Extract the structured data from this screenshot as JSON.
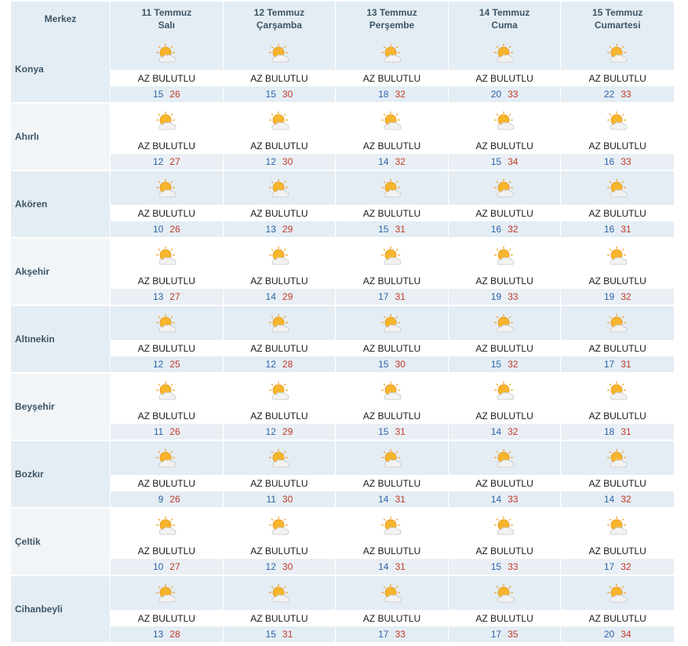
{
  "header": {
    "location_label": "Merkez",
    "days": [
      {
        "date": "11 Temmuz",
        "weekday": "Salı"
      },
      {
        "date": "12 Temmuz",
        "weekday": "Çarşamba"
      },
      {
        "date": "13 Temmuz",
        "weekday": "Perşembe"
      },
      {
        "date": "14 Temmuz",
        "weekday": "Cuma"
      },
      {
        "date": "15 Temmuz",
        "weekday": "Cumartesi"
      }
    ]
  },
  "icon": "partly-cloudy-icon",
  "colors": {
    "min": "#2b64a8",
    "max": "#c0392b",
    "band": "#e4edf4"
  },
  "rows": [
    {
      "name": "Konya",
      "days": [
        {
          "cond": "AZ BULUTLU",
          "min": "15",
          "max": "26"
        },
        {
          "cond": "AZ BULUTLU",
          "min": "15",
          "max": "30"
        },
        {
          "cond": "AZ BULUTLU",
          "min": "18",
          "max": "32"
        },
        {
          "cond": "AZ BULUTLU",
          "min": "20",
          "max": "33"
        },
        {
          "cond": "AZ BULUTLU",
          "min": "22",
          "max": "33"
        }
      ]
    },
    {
      "name": "Ahırlı",
      "days": [
        {
          "cond": "AZ BULUTLU",
          "min": "12",
          "max": "27"
        },
        {
          "cond": "AZ BULUTLU",
          "min": "12",
          "max": "30"
        },
        {
          "cond": "AZ BULUTLU",
          "min": "14",
          "max": "32"
        },
        {
          "cond": "AZ BULUTLU",
          "min": "15",
          "max": "34"
        },
        {
          "cond": "AZ BULUTLU",
          "min": "16",
          "max": "33"
        }
      ]
    },
    {
      "name": "Akören",
      "days": [
        {
          "cond": "AZ BULUTLU",
          "min": "10",
          "max": "26"
        },
        {
          "cond": "AZ BULUTLU",
          "min": "13",
          "max": "29"
        },
        {
          "cond": "AZ BULUTLU",
          "min": "15",
          "max": "31"
        },
        {
          "cond": "AZ BULUTLU",
          "min": "16",
          "max": "32"
        },
        {
          "cond": "AZ BULUTLU",
          "min": "16",
          "max": "31"
        }
      ]
    },
    {
      "name": "Akşehir",
      "days": [
        {
          "cond": "AZ BULUTLU",
          "min": "13",
          "max": "27"
        },
        {
          "cond": "AZ BULUTLU",
          "min": "14",
          "max": "29"
        },
        {
          "cond": "AZ BULUTLU",
          "min": "17",
          "max": "31"
        },
        {
          "cond": "AZ BULUTLU",
          "min": "19",
          "max": "33"
        },
        {
          "cond": "AZ BULUTLU",
          "min": "19",
          "max": "32"
        }
      ]
    },
    {
      "name": "Altınekin",
      "days": [
        {
          "cond": "AZ BULUTLU",
          "min": "12",
          "max": "25"
        },
        {
          "cond": "AZ BULUTLU",
          "min": "12",
          "max": "28"
        },
        {
          "cond": "AZ BULUTLU",
          "min": "15",
          "max": "30"
        },
        {
          "cond": "AZ BULUTLU",
          "min": "15",
          "max": "32"
        },
        {
          "cond": "AZ BULUTLU",
          "min": "17",
          "max": "31"
        }
      ]
    },
    {
      "name": "Beyşehir",
      "days": [
        {
          "cond": "AZ BULUTLU",
          "min": "11",
          "max": "26"
        },
        {
          "cond": "AZ BULUTLU",
          "min": "12",
          "max": "29"
        },
        {
          "cond": "AZ BULUTLU",
          "min": "15",
          "max": "31"
        },
        {
          "cond": "AZ BULUTLU",
          "min": "14",
          "max": "32"
        },
        {
          "cond": "AZ BULUTLU",
          "min": "18",
          "max": "31"
        }
      ]
    },
    {
      "name": "Bozkır",
      "days": [
        {
          "cond": "AZ BULUTLU",
          "min": "9",
          "max": "26"
        },
        {
          "cond": "AZ BULUTLU",
          "min": "11",
          "max": "30"
        },
        {
          "cond": "AZ BULUTLU",
          "min": "14",
          "max": "31"
        },
        {
          "cond": "AZ BULUTLU",
          "min": "14",
          "max": "33"
        },
        {
          "cond": "AZ BULUTLU",
          "min": "14",
          "max": "32"
        }
      ]
    },
    {
      "name": "Çeltik",
      "days": [
        {
          "cond": "AZ BULUTLU",
          "min": "10",
          "max": "27"
        },
        {
          "cond": "AZ BULUTLU",
          "min": "12",
          "max": "30"
        },
        {
          "cond": "AZ BULUTLU",
          "min": "14",
          "max": "31"
        },
        {
          "cond": "AZ BULUTLU",
          "min": "15",
          "max": "33"
        },
        {
          "cond": "AZ BULUTLU",
          "min": "17",
          "max": "32"
        }
      ]
    },
    {
      "name": "Cihanbeyli",
      "days": [
        {
          "cond": "AZ BULUTLU",
          "min": "13",
          "max": "28"
        },
        {
          "cond": "AZ BULUTLU",
          "min": "15",
          "max": "31"
        },
        {
          "cond": "AZ BULUTLU",
          "min": "17",
          "max": "33"
        },
        {
          "cond": "AZ BULUTLU",
          "min": "17",
          "max": "35"
        },
        {
          "cond": "AZ BULUTLU",
          "min": "20",
          "max": "34"
        }
      ]
    }
  ]
}
